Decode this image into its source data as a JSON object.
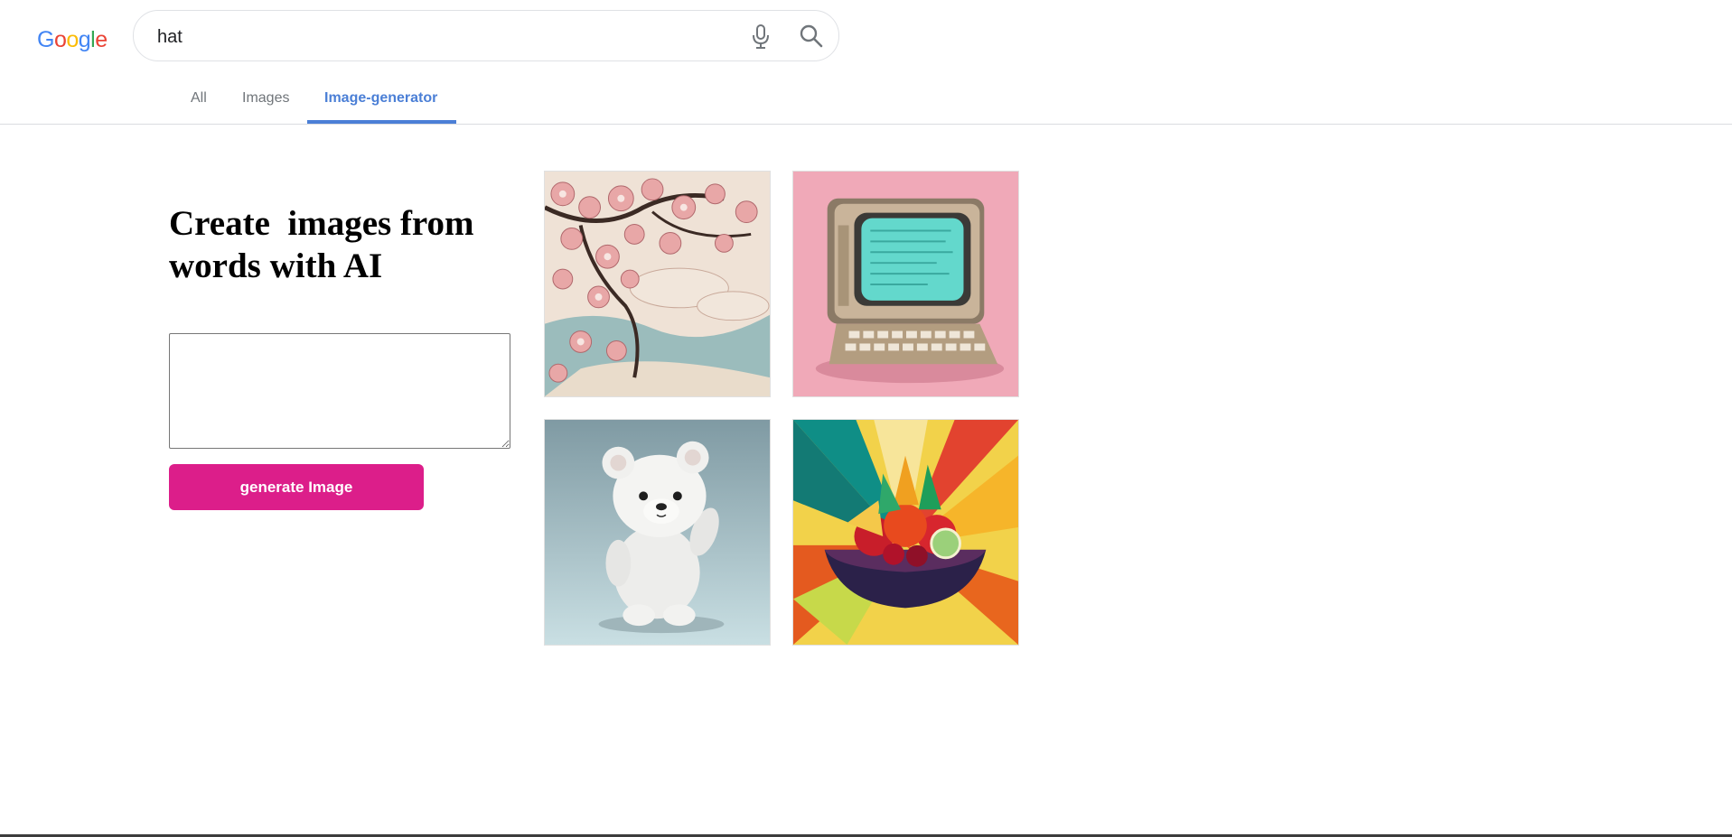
{
  "header": {
    "logo_letters": [
      "G",
      "o",
      "o",
      "g",
      "l",
      "e"
    ],
    "logo_colors": [
      "#4285f4",
      "#ea4335",
      "#fbbc05",
      "#4285f4",
      "#34a853",
      "#ea4335"
    ],
    "search": {
      "value": "hat",
      "mic_icon": "microphone-icon",
      "search_icon": "search-icon"
    }
  },
  "tabs": [
    {
      "label": "All"
    },
    {
      "label": "Images"
    },
    {
      "label": "Image-generator",
      "active": true
    }
  ],
  "accent_color": "#4b7fd6",
  "main": {
    "headline": "Create  images from words with AI",
    "prompt_value": "",
    "generate_label": "generate Image",
    "generate_color": "#dc1e8a"
  },
  "gallery": [
    {
      "subject": "cherry-blossom-artwork"
    },
    {
      "subject": "retro-computer-artwork"
    },
    {
      "subject": "white-teddy-bear-artwork"
    },
    {
      "subject": "fruit-bowl-artwork"
    }
  ]
}
